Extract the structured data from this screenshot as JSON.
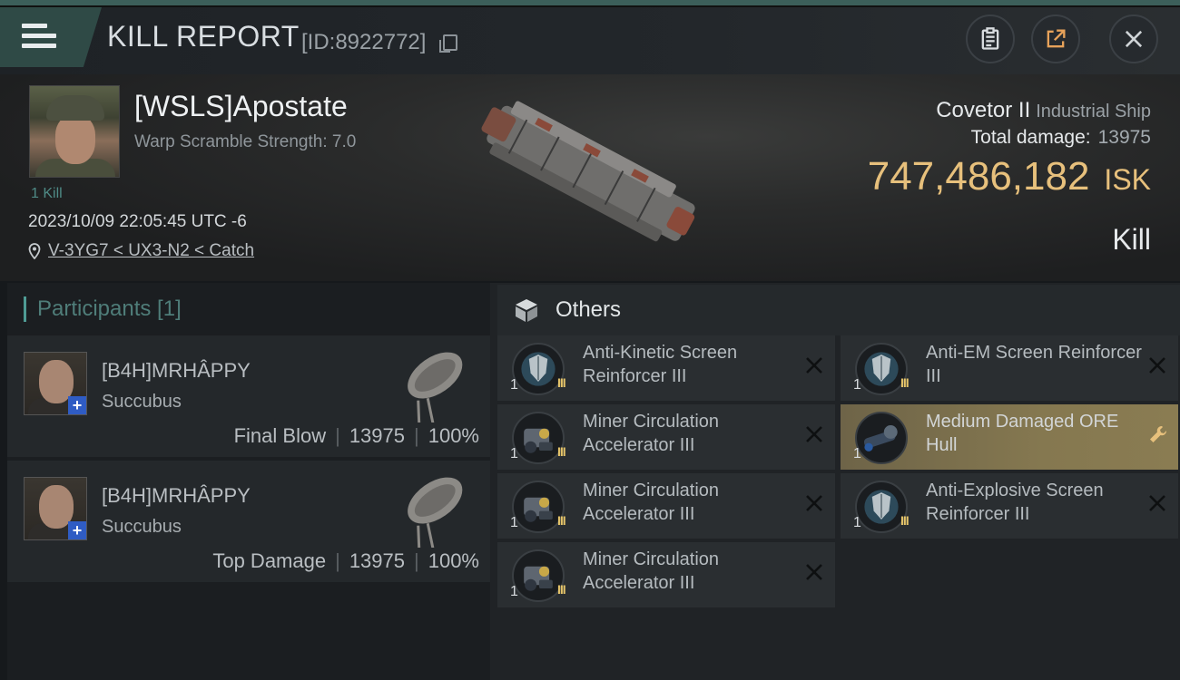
{
  "header": {
    "title": "KILL REPORT",
    "id_text": "[ID:8922772]"
  },
  "victim": {
    "name": "[WSLS]Apostate",
    "warp_scramble": "Warp Scramble Strength: 7.0",
    "kills": "1 Kill",
    "datetime": "2023/10/09 22:05:45 UTC -6",
    "location": "V-3YG7 < UX3-N2 < Catch",
    "ship_name": "Covetor II",
    "ship_class": "Industrial Ship",
    "total_damage_label": "Total damage:",
    "total_damage": "13975",
    "isk_value": "747,486,182",
    "isk_unit": "ISK",
    "kill_type": "Kill"
  },
  "participants": {
    "title": "Participants [1]",
    "items": [
      {
        "name": "[B4H]MRHÂPPY",
        "ship": "Succubus",
        "role": "Final Blow",
        "damage": "13975",
        "percent": "100%"
      },
      {
        "name": "[B4H]MRHÂPPY",
        "ship": "Succubus",
        "role": "Top Damage",
        "damage": "13975",
        "percent": "100%"
      }
    ]
  },
  "others": {
    "title": "Others",
    "items": [
      {
        "name": "Anti-Kinetic Screen Reinforcer III",
        "qty": "1",
        "meta": "III",
        "icon": "shield-module-icon",
        "highlight": false
      },
      {
        "name": "Anti-EM Screen Reinforcer III",
        "qty": "1",
        "meta": "III",
        "icon": "shield-module-icon",
        "highlight": false
      },
      {
        "name": "Miner Circulation Accelerator III",
        "qty": "1",
        "meta": "III",
        "icon": "mining-module-icon",
        "highlight": false
      },
      {
        "name": "Medium Damaged ORE Hull",
        "qty": "1",
        "meta": "",
        "icon": "hull-part-icon",
        "highlight": true
      },
      {
        "name": "Miner Circulation Accelerator III",
        "qty": "1",
        "meta": "III",
        "icon": "mining-module-icon",
        "highlight": false
      },
      {
        "name": "Anti-Explosive Screen Reinforcer III",
        "qty": "1",
        "meta": "III",
        "icon": "shield-module-icon",
        "highlight": false
      },
      {
        "name": "Miner Circulation Accelerator III",
        "qty": "1",
        "meta": "III",
        "icon": "mining-module-icon",
        "highlight": false
      }
    ]
  },
  "colors": {
    "accent_teal": "#4f9c95",
    "isk_gold": "#e7c07c",
    "highlight": "#857850"
  }
}
